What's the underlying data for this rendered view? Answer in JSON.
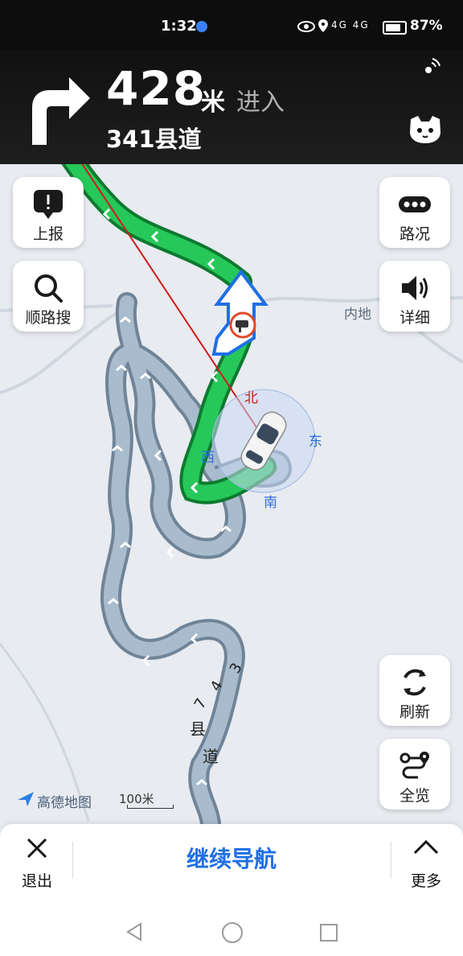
{
  "status_bar": {
    "time": "1:32",
    "network_icons": "4G 4G",
    "battery": "87%"
  },
  "nav_header": {
    "distance": "428",
    "unit": "米",
    "action": "进入",
    "road": "341县道",
    "turn_icon": "turn-right-arrow-icon"
  },
  "map_buttons": {
    "report": "上报",
    "along_search": "顺路搜",
    "traffic": "路况",
    "detail": "详细",
    "refresh": "刷新",
    "overview": "全览"
  },
  "map": {
    "place_label": "内地",
    "road_label_digits": [
      "3",
      "4",
      "7"
    ],
    "road_label_chars": [
      "县",
      "道"
    ],
    "compass": {
      "north": "北",
      "east": "东",
      "south": "南",
      "west": "西"
    },
    "brand": "高德地图",
    "scale": "100米",
    "route_color": "#22b94c",
    "road_color": "#8da4b8"
  },
  "bottom_bar": {
    "exit": "退出",
    "continue": "继续导航",
    "more": "更多"
  }
}
